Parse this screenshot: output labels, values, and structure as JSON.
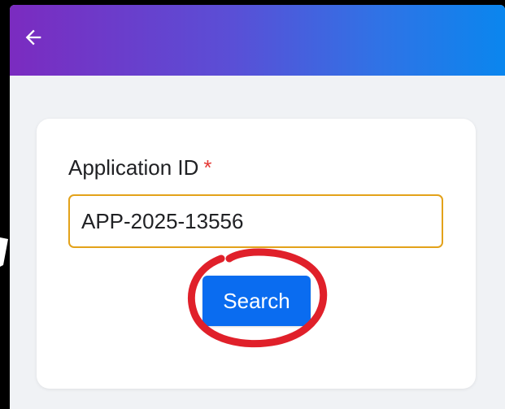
{
  "form": {
    "field_label": "Application ID",
    "required_marker": "*",
    "application_id_value": "APP-2025-13556",
    "search_label": "Search"
  },
  "colors": {
    "appbar_gradient_start": "#7b2bc0",
    "appbar_gradient_end": "#0a86ee",
    "input_border_focus": "#e3a21a",
    "primary_button": "#0a6cf0",
    "required_marker": "#e53935",
    "annotation": "#e0202a"
  },
  "icons": {
    "back": "arrow-left-icon"
  }
}
